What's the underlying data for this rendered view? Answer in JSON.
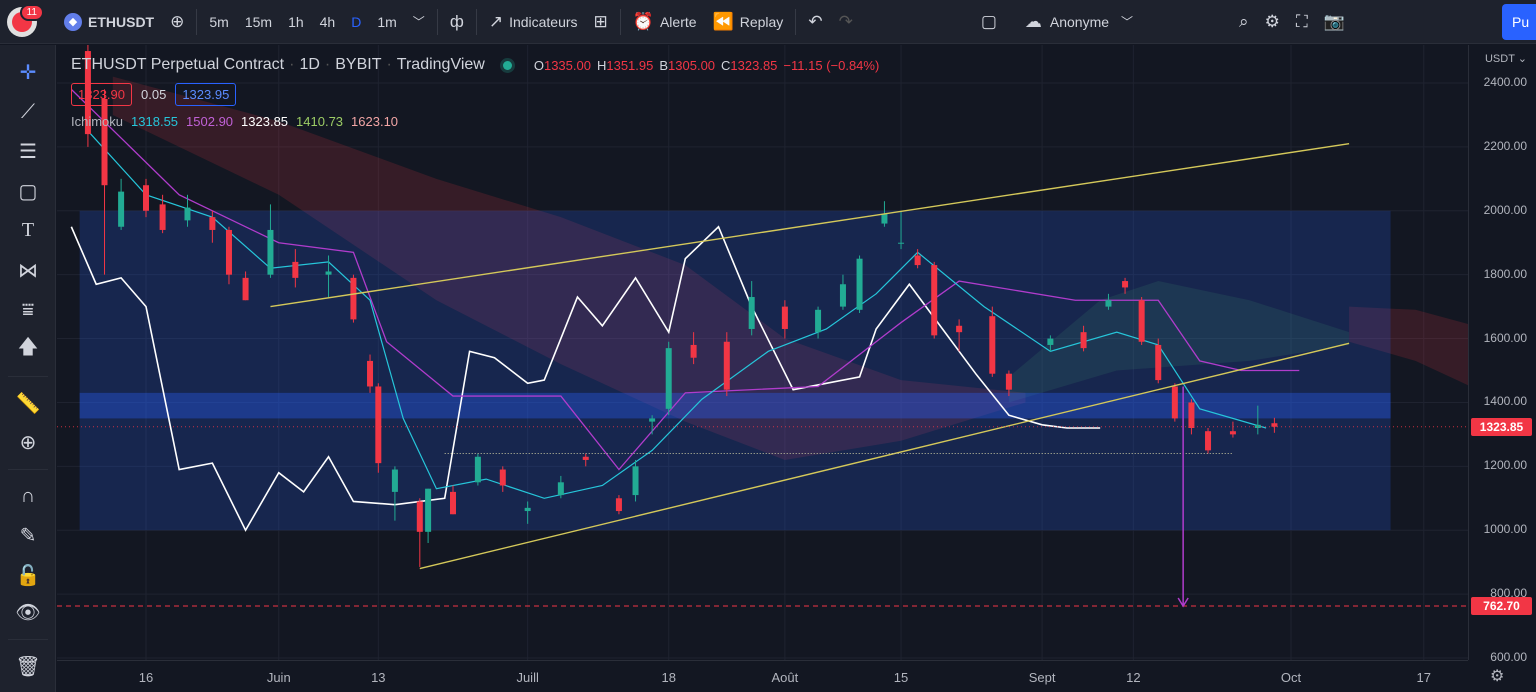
{
  "toolbar": {
    "notification_count": "11",
    "symbol": "ETHUSDT",
    "symbol_icon": "ethereum-icon",
    "timeframes": [
      "5m",
      "15m",
      "1h",
      "4h",
      "D",
      "1m"
    ],
    "active_timeframe": "D",
    "indicators_label": "Indicateurs",
    "alert_label": "Alerte",
    "replay_label": "Replay",
    "layout_name": "Anonyme",
    "publish_label": "Pu"
  },
  "legend": {
    "title": "ETHUSDT Perpetual Contract",
    "interval": "1D",
    "exchange": "BYBIT",
    "source": "TradingView",
    "open_key": "O",
    "open": "1335.00",
    "high_key": "H",
    "high": "1351.95",
    "low_key": "B",
    "low": "1305.00",
    "close_key": "C",
    "close": "1323.85",
    "change": "−11.15 (−0.84%)",
    "bid": "1323.90",
    "spread": "0.05",
    "ask": "1323.95",
    "indicator_name": "Ichimoku",
    "ichimoku_values": [
      "1318.55",
      "1502.90",
      "1323.85",
      "1410.73",
      "1623.10"
    ],
    "ichimoku_colors": [
      "#26c6da",
      "#b03ccc",
      "#ffffff",
      "#9ccc65",
      "#f2a5a5"
    ]
  },
  "price_scale": {
    "currency_label": "USDT",
    "ticks": [
      "2400.00",
      "2200.00",
      "2000.00",
      "1800.00",
      "1600.00",
      "1400.00",
      "1200.00",
      "1000.00",
      "800.00",
      "600.00"
    ],
    "last_price_label": "1323.85",
    "target_price_label": "762.70"
  },
  "time_scale": {
    "ticks": [
      "16",
      "Juin",
      "13",
      "Juill",
      "18",
      "Août",
      "15",
      "Sept",
      "12",
      "Oct",
      "17"
    ]
  },
  "colors": {
    "up": "#22ab94",
    "down": "#f23645",
    "trendline": "#d4c85a",
    "range_box": "#2962ff",
    "lagging_span": "#ffffff",
    "tenkan": "#26c6da",
    "kijun": "#b03ccc",
    "cloud_bull": "#4caf50",
    "cloud_bear": "#f23645",
    "target_line": "#f23645"
  },
  "chart_data": {
    "type": "candlestick",
    "title": "ETHUSDT Perpetual Contract",
    "interval": "1D",
    "ylim": [
      600,
      2500
    ],
    "x_range": [
      "2022-05-07",
      "2022-10-26"
    ],
    "grid": true,
    "candles_approx": [
      [
        "2022-05-09",
        2500,
        2520,
        2200,
        2240
      ],
      [
        "2022-05-11",
        2350,
        2380,
        1800,
        2080
      ],
      [
        "2022-05-13",
        1950,
        2100,
        1940,
        2060
      ],
      [
        "2022-05-16",
        2080,
        2100,
        1980,
        2000
      ],
      [
        "2022-05-18",
        2020,
        2050,
        1930,
        1940
      ],
      [
        "2022-05-21",
        1970,
        2050,
        1950,
        2010
      ],
      [
        "2022-05-24",
        1980,
        2000,
        1900,
        1940
      ],
      [
        "2022-05-26",
        1940,
        1950,
        1770,
        1800
      ],
      [
        "2022-05-28",
        1790,
        1810,
        1720,
        1720
      ],
      [
        "2022-05-31",
        1800,
        2020,
        1790,
        1940
      ],
      [
        "2022-06-03",
        1840,
        1880,
        1760,
        1790
      ],
      [
        "2022-06-07",
        1800,
        1860,
        1730,
        1810
      ],
      [
        "2022-06-10",
        1790,
        1800,
        1650,
        1660
      ],
      [
        "2022-06-12",
        1530,
        1550,
        1430,
        1450
      ],
      [
        "2022-06-13",
        1450,
        1460,
        1180,
        1210
      ],
      [
        "2022-06-15",
        1120,
        1200,
        1030,
        1190
      ],
      [
        "2022-06-18",
        1090,
        1100,
        885,
        995
      ],
      [
        "2022-06-19",
        995,
        1130,
        960,
        1130
      ],
      [
        "2022-06-22",
        1120,
        1140,
        1050,
        1050
      ],
      [
        "2022-06-25",
        1150,
        1240,
        1140,
        1230
      ],
      [
        "2022-06-28",
        1190,
        1200,
        1120,
        1140
      ],
      [
        "2022-07-01",
        1060,
        1090,
        1020,
        1070
      ],
      [
        "2022-07-05",
        1110,
        1170,
        1100,
        1150
      ],
      [
        "2022-07-08",
        1230,
        1240,
        1200,
        1220
      ],
      [
        "2022-07-12",
        1100,
        1110,
        1050,
        1060
      ],
      [
        "2022-07-14",
        1110,
        1220,
        1090,
        1200
      ],
      [
        "2022-07-16",
        1340,
        1360,
        1300,
        1350
      ],
      [
        "2022-07-18",
        1380,
        1590,
        1360,
        1570
      ],
      [
        "2022-07-21",
        1580,
        1620,
        1520,
        1540
      ],
      [
        "2022-07-25",
        1590,
        1620,
        1420,
        1440
      ],
      [
        "2022-07-28",
        1630,
        1780,
        1610,
        1730
      ],
      [
        "2022-08-01",
        1700,
        1720,
        1600,
        1630
      ],
      [
        "2022-08-05",
        1620,
        1700,
        1600,
        1690
      ],
      [
        "2022-08-08",
        1700,
        1800,
        1690,
        1770
      ],
      [
        "2022-08-10",
        1690,
        1860,
        1680,
        1850
      ],
      [
        "2022-08-13",
        1960,
        2030,
        1950,
        1990
      ],
      [
        "2022-08-15",
        1900,
        2000,
        1880,
        1900
      ],
      [
        "2022-08-17",
        1860,
        1880,
        1820,
        1830
      ],
      [
        "2022-08-19",
        1830,
        1840,
        1600,
        1610
      ],
      [
        "2022-08-22",
        1640,
        1660,
        1560,
        1620
      ],
      [
        "2022-08-26",
        1670,
        1700,
        1480,
        1490
      ],
      [
        "2022-08-28",
        1490,
        1500,
        1420,
        1440
      ],
      [
        "2022-09-02",
        1580,
        1610,
        1560,
        1600
      ],
      [
        "2022-09-06",
        1620,
        1640,
        1560,
        1570
      ],
      [
        "2022-09-09",
        1700,
        1740,
        1690,
        1720
      ],
      [
        "2022-09-11",
        1780,
        1790,
        1740,
        1760
      ],
      [
        "2022-09-13",
        1720,
        1730,
        1580,
        1590
      ],
      [
        "2022-09-15",
        1580,
        1600,
        1460,
        1470
      ],
      [
        "2022-09-17",
        1450,
        1460,
        1340,
        1350
      ],
      [
        "2022-09-19",
        1400,
        1410,
        1300,
        1320
      ],
      [
        "2022-09-21",
        1310,
        1320,
        1240,
        1250
      ],
      [
        "2022-09-24",
        1310,
        1340,
        1290,
        1300
      ],
      [
        "2022-09-27",
        1320,
        1390,
        1300,
        1330
      ],
      [
        "2022-09-29",
        1335,
        1352,
        1305,
        1324
      ]
    ],
    "annotations": {
      "range_box": {
        "from": "2022-05-08",
        "to": "2022-10-13",
        "low": 1000,
        "high": 2000
      },
      "highlight_band": {
        "low": 1350,
        "high": 1430
      },
      "dotted_support": {
        "from": "2022-06-21",
        "to": "2022-09-24",
        "price": 1240
      },
      "channel_upper": [
        [
          "2022-05-31",
          1700
        ],
        [
          "2022-10-08",
          2210
        ]
      ],
      "channel_lower": [
        [
          "2022-06-18",
          880
        ],
        [
          "2022-10-08",
          1585
        ]
      ],
      "target_arrow": {
        "date": "2022-09-18",
        "from": 1450,
        "to": 762.7
      },
      "target_level": 762.7,
      "last_price": 1323.85
    }
  }
}
